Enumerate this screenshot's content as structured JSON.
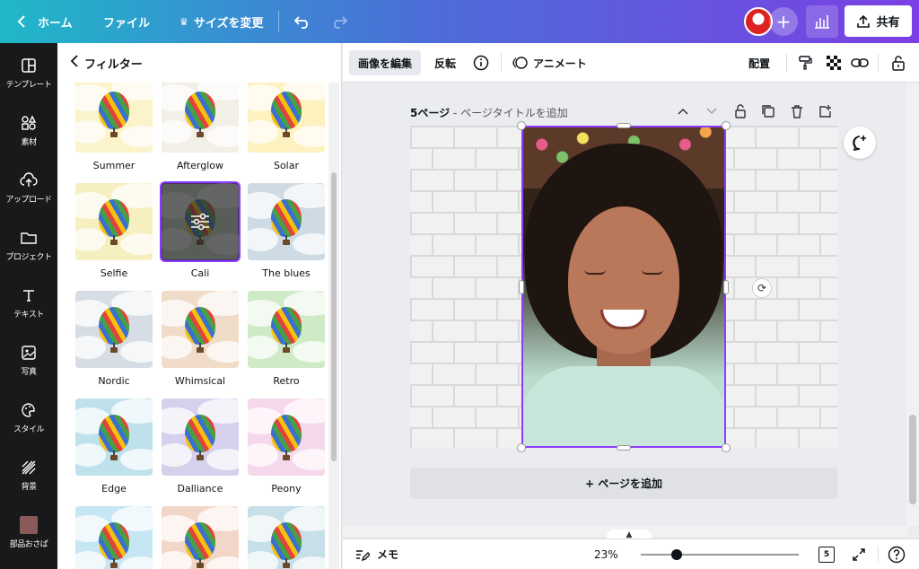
{
  "topbar": {
    "home_label": "ホーム",
    "file_label": "ファイル",
    "resize_label": "サイズを変更",
    "share_label": "共有",
    "add_label": "+"
  },
  "rail": {
    "items": [
      {
        "label": "テンプレート",
        "icon": "template-icon"
      },
      {
        "label": "素材",
        "icon": "elements-icon"
      },
      {
        "label": "アップロード",
        "icon": "upload-icon"
      },
      {
        "label": "プロジェクト",
        "icon": "folder-icon"
      },
      {
        "label": "テキスト",
        "icon": "text-icon"
      },
      {
        "label": "写真",
        "icon": "photo-icon"
      },
      {
        "label": "スタイル",
        "icon": "palette-icon"
      },
      {
        "label": "背景",
        "icon": "background-icon"
      },
      {
        "label": "部品おさば",
        "icon": "app-icon"
      }
    ]
  },
  "panel": {
    "title": "フィルター",
    "filters": [
      {
        "name": "Summer",
        "tint": "#fbf3c9"
      },
      {
        "name": "Afterglow",
        "tint": "#f2efe6"
      },
      {
        "name": "Solar",
        "tint": "#fdf1bf"
      },
      {
        "name": "Selfie",
        "tint": "#f6efc0"
      },
      {
        "name": "Cali",
        "tint": "#cbd9c8"
      },
      {
        "name": "The blues",
        "tint": "#cfdbe4"
      },
      {
        "name": "Nordic",
        "tint": "#d7dde4"
      },
      {
        "name": "Whimsical",
        "tint": "#f1dcc9"
      },
      {
        "name": "Retro",
        "tint": "#cfeac6"
      },
      {
        "name": "Edge",
        "tint": "#bfe1ec"
      },
      {
        "name": "Dalliance",
        "tint": "#d6d0ec"
      },
      {
        "name": "Peony",
        "tint": "#f6d8ec"
      },
      {
        "name": "",
        "tint": "#c7e6f3"
      },
      {
        "name": "",
        "tint": "#f2d7c8"
      },
      {
        "name": "",
        "tint": "#c7dfe8"
      }
    ],
    "selected": "Cali"
  },
  "edbar": {
    "edit_image": "画像を編集",
    "flip": "反転",
    "animate": "アニメート",
    "position": "配置"
  },
  "canvas": {
    "page_number": "5ページ",
    "page_title_placeholder": " - ページタイトルを追加",
    "add_page": "+ ページを追加"
  },
  "bottom": {
    "memo": "メモ",
    "zoom": "23%",
    "zoom_fraction": 0.23,
    "page_count": "5"
  },
  "colors": {
    "accent": "#8b3dff",
    "rail_bg": "#18191b"
  }
}
